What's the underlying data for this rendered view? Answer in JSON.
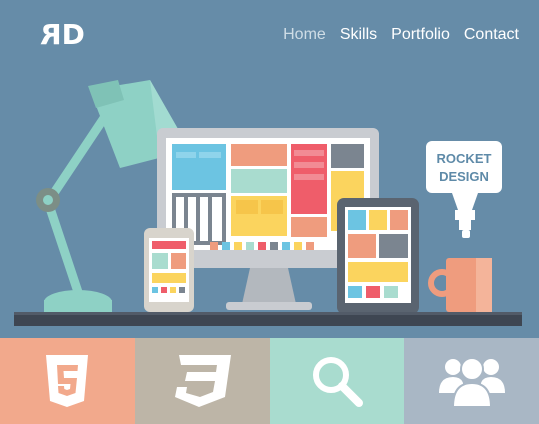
{
  "brand": {
    "logo_text": "RD"
  },
  "nav": {
    "items": [
      {
        "label": "Home",
        "active": true
      },
      {
        "label": "Skills",
        "active": false
      },
      {
        "label": "Portfolio",
        "active": false
      },
      {
        "label": "Contact",
        "active": false
      }
    ]
  },
  "hero": {
    "sign_line1": "ROCKET",
    "sign_line2": "DESIGN"
  },
  "tiles": [
    {
      "icon": "html5-icon",
      "color": "#f2a98c"
    },
    {
      "icon": "css3-icon",
      "color": "#bdb5a7"
    },
    {
      "icon": "search-icon",
      "color": "#a9dccf"
    },
    {
      "icon": "users-icon",
      "color": "#a9b7c5"
    }
  ],
  "colors": {
    "background": "#668ca8",
    "lamp": "#8ed1c5",
    "desk": "#3e4652"
  }
}
